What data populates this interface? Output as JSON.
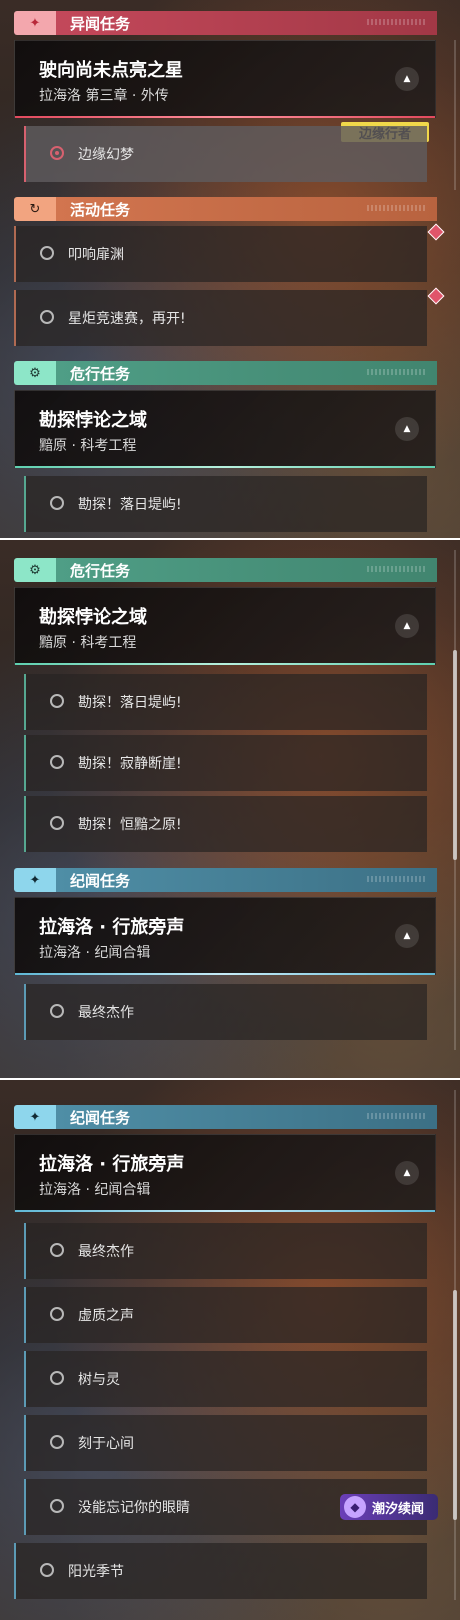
{
  "categories": {
    "yiwen": "异闻任务",
    "huodong": "活动任务",
    "weixing": "危行任务",
    "jiwen": "纪闻任务"
  },
  "quests": {
    "yiwen_main": {
      "title": "驶向尚未点亮之星",
      "subtitle": "拉海洛 第三章 · 外传"
    },
    "weixing_main": {
      "title": "勘探悖论之域",
      "subtitle": "黯原 · 科考工程"
    },
    "jiwen_main": {
      "title": "拉海洛 · 行旅旁声",
      "subtitle": "拉海洛 · 纪闻合辑"
    }
  },
  "subquests": {
    "biyuan_huanmeng": "边缘幻梦",
    "kouxiang_feiyuan": "叩响扉渊",
    "xingju_race": "星炬竞速赛，再开!",
    "luori_diyu": "勘探！落日堤屿!",
    "jijing_duanya": "勘探！寂静断崖!",
    "hengan_zhiyuan": "勘探！恒黯之原!",
    "zuizhong_jiezuo": "最终杰作",
    "xuzhi_zhisheng": "虚质之声",
    "shu_yu_ling": "树与灵",
    "keyu_xinjian": "刻于心间",
    "mei_neng_wangji": "没能忘记你的眼睛",
    "yangguang_jijie": "阳光季节"
  },
  "badge": "边缘行者",
  "watermark": "潮汐续闻",
  "icons": {
    "yiwen": "star-burst-icon",
    "huodong": "refresh-icon",
    "weixing": "gear-icon",
    "jiwen": "sparkle-icon",
    "expand": "chevron-up-icon"
  },
  "colors": {
    "yiwen": "#c3485a",
    "huodong": "#d2754f",
    "weixing": "#4f9e86",
    "jiwen": "#4f8ea6",
    "badge": "#f1d84a"
  }
}
